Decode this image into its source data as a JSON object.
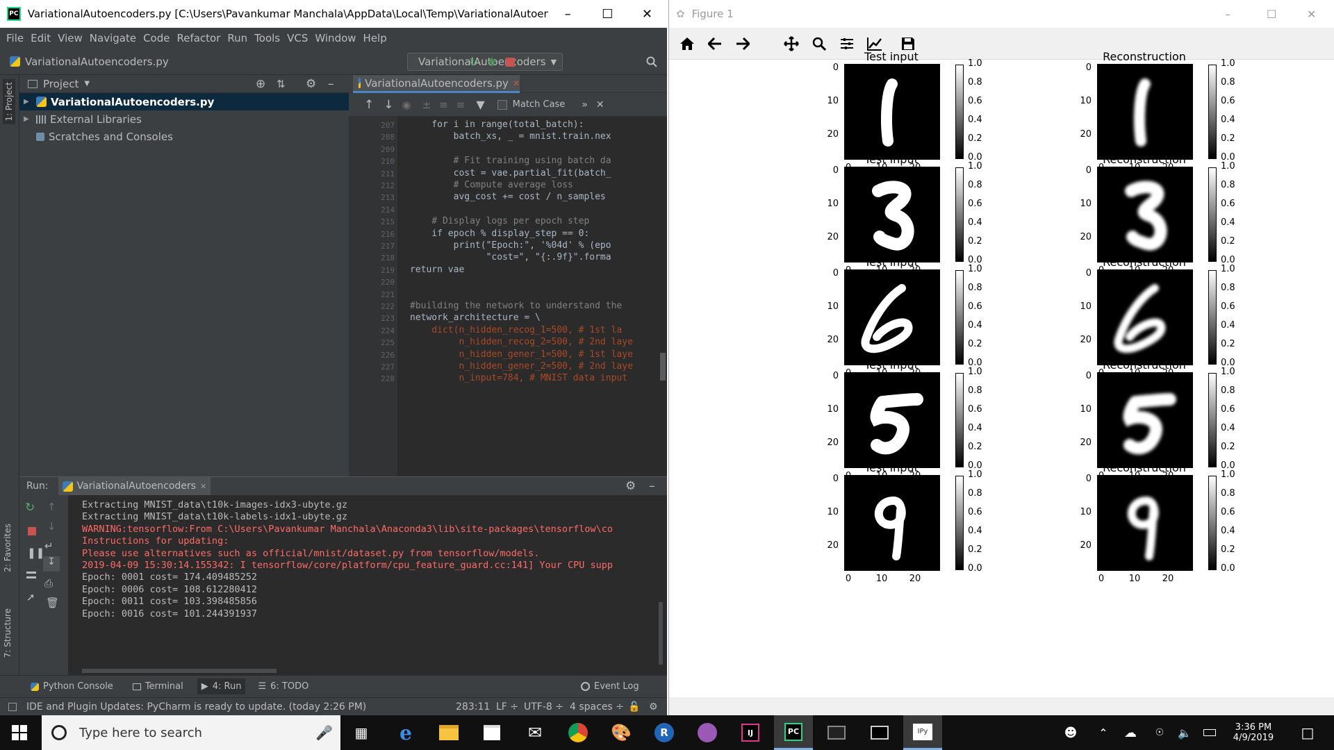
{
  "pycharm": {
    "title": "VariationalAutoencoders.py [C:\\Users\\Pavankumar Manchala\\AppData\\Local\\Temp\\VariationalAutoencoders.py...",
    "menu": [
      "File",
      "Edit",
      "View",
      "Navigate",
      "Code",
      "Refactor",
      "Run",
      "Tools",
      "VCS",
      "Window",
      "Help"
    ],
    "breadcrumb": "VariationalAutoencoders.py",
    "run_config": "VariationalAutoencoders",
    "left_tabs": {
      "project": "1: Project",
      "favorites": "2: Favorites",
      "structure": "7: Structure"
    },
    "project_panel": {
      "title": "Project",
      "items": [
        "VariationalAutoencoders.py",
        "External Libraries",
        "Scratches and Consoles"
      ]
    },
    "editor": {
      "tab": "VariationalAutoencoders.py",
      "match_case": "Match Case",
      "lines": [
        {
          "n": "207",
          "t": "    for i in range(total_batch):"
        },
        {
          "n": "208",
          "t": "        batch_xs, _ = mnist.train.nex"
        },
        {
          "n": "209",
          "t": ""
        },
        {
          "n": "210",
          "t": "        # Fit training using batch da"
        },
        {
          "n": "211",
          "t": "        cost = vae.partial_fit(batch_"
        },
        {
          "n": "212",
          "t": "        # Compute average loss"
        },
        {
          "n": "213",
          "t": "        avg_cost += cost / n_samples"
        },
        {
          "n": "214",
          "t": ""
        },
        {
          "n": "215",
          "t": "    # Display logs per epoch step"
        },
        {
          "n": "216",
          "t": "    if epoch % display_step == 0:"
        },
        {
          "n": "217",
          "t": "        print(\"Epoch:\", '%04d' % (epo"
        },
        {
          "n": "218",
          "t": "              \"cost=\", \"{:.9f}\".forma"
        },
        {
          "n": "219",
          "t": "return vae"
        },
        {
          "n": "220",
          "t": ""
        },
        {
          "n": "221",
          "t": ""
        },
        {
          "n": "222",
          "t": "#building the network to understand the"
        },
        {
          "n": "223",
          "t": "network_architecture = \\"
        },
        {
          "n": "224",
          "t": "    dict(n_hidden_recog_1=500, # 1st la"
        },
        {
          "n": "225",
          "t": "         n_hidden_recog_2=500, # 2nd laye"
        },
        {
          "n": "226",
          "t": "         n_hidden_gener_1=500, # 1st laye"
        },
        {
          "n": "227",
          "t": "         n_hidden_gener_2=500, # 2nd laye"
        },
        {
          "n": "228",
          "t": "         n_input=784, # MNIST data input"
        }
      ]
    },
    "run_panel": {
      "label": "Run:",
      "tab": "VariationalAutoencoders",
      "console": [
        {
          "t": "Extracting MNIST_data\\t10k-images-idx3-ubyte.gz",
          "c": "n"
        },
        {
          "t": "Extracting MNIST_data\\t10k-labels-idx1-ubyte.gz",
          "c": "n"
        },
        {
          "t": "WARNING:tensorflow:From C:\\Users\\Pavankumar Manchala\\Anaconda3\\lib\\site-packages\\tensorflow\\co",
          "c": "r"
        },
        {
          "t": "Instructions for updating:",
          "c": "r"
        },
        {
          "t": "Please use alternatives such as official/mnist/dataset.py from tensorflow/models.",
          "c": "r"
        },
        {
          "t": "2019-04-09 15:30:14.155342: I tensorflow/core/platform/cpu_feature_guard.cc:141] Your CPU supp",
          "c": "r"
        },
        {
          "t": "Epoch: 0001 cost= 174.409485252",
          "c": "n"
        },
        {
          "t": "Epoch: 0006 cost= 108.612280412",
          "c": "n"
        },
        {
          "t": "Epoch: 0011 cost= 103.398485856",
          "c": "n"
        },
        {
          "t": "Epoch: 0016 cost= 101.244391937",
          "c": "n"
        }
      ]
    },
    "bottom_tabs": [
      "Python Console",
      "Terminal",
      "4: Run",
      "6: TODO"
    ],
    "event_log": "Event Log",
    "status": {
      "message": "IDE and Plugin Updates: PyCharm is ready to update. (today 2:26 PM)",
      "position": "283:11",
      "line_sep": "LF ÷",
      "encoding": "UTF-8 ÷",
      "indent": "4 spaces ÷"
    }
  },
  "figure": {
    "title": "Figure 1",
    "col_titles": [
      "Test input",
      "Reconstruction"
    ],
    "yticks": [
      "0",
      "10",
      "20"
    ],
    "xticks": [
      "0",
      "10",
      "20"
    ],
    "cbar_ticks": [
      "1.0",
      "0.8",
      "0.6",
      "0.4",
      "0.2",
      "0.0"
    ],
    "digits": [
      "1",
      "3",
      "6",
      "5",
      "9"
    ]
  },
  "taskbar": {
    "search_placeholder": "Type here to search",
    "time": "3:36 PM",
    "date": "4/9/2019"
  },
  "colors": {
    "ide_bg": "#3c3f41",
    "editor_bg": "#2b2b2b",
    "error_red": "#ff6b68",
    "accent": "#4a88c7"
  }
}
